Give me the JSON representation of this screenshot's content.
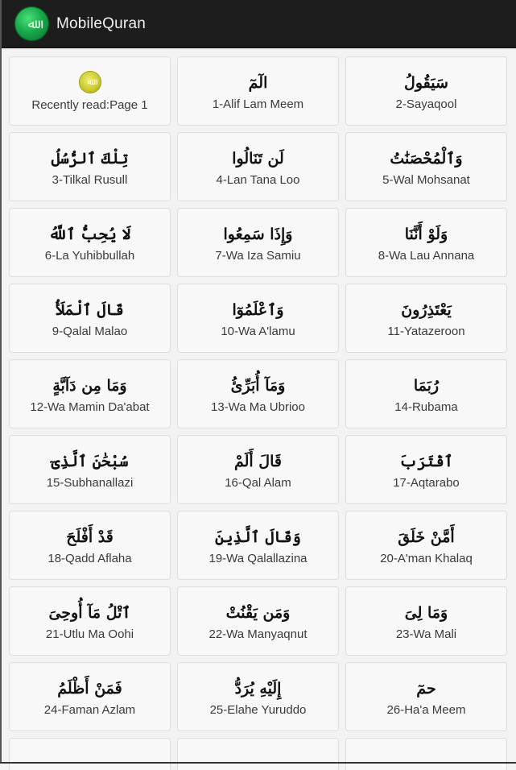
{
  "app": {
    "title": "MobileQuran",
    "icon": "quran-logo-icon"
  },
  "recent": {
    "label": "Recently read:Page 1",
    "icon": "quran-gold-icon"
  },
  "paras": [
    {
      "arabic": "الٓمٓ",
      "label": "1-Alif Lam Meem"
    },
    {
      "arabic": "سَيَقُولُ",
      "label": "2-Sayaqool"
    },
    {
      "arabic": "تِلْكَ ٱلرُّسُلُ",
      "label": "3-Tilkal Rusull"
    },
    {
      "arabic": "لَن تَنَالُوا",
      "label": "4-Lan Tana Loo"
    },
    {
      "arabic": "وَٱلْمُحْصَنَٰتُ",
      "label": "5-Wal Mohsanat"
    },
    {
      "arabic": "لَا يُحِبُّ ٱللَّهُ",
      "label": "6-La Yuhibbullah"
    },
    {
      "arabic": "وَإِذَا سَمِعُوا",
      "label": "7-Wa Iza Samiu"
    },
    {
      "arabic": "وَلَوْ أَنَّنَا",
      "label": "8-Wa Lau Annana"
    },
    {
      "arabic": "قَالَ ٱلْمَلَأُ",
      "label": "9-Qalal Malao"
    },
    {
      "arabic": "وَٱعْلَمُوٓا",
      "label": "10-Wa A'lamu"
    },
    {
      "arabic": "يَعْتَذِرُونَ",
      "label": "11-Yatazeroon"
    },
    {
      "arabic": "وَمَا مِن دَآبَّةٍ",
      "label": "12-Wa Mamin Da'abat"
    },
    {
      "arabic": "وَمَآ أُبَرِّئُ",
      "label": "13-Wa Ma Ubrioo"
    },
    {
      "arabic": "رُبَمَا",
      "label": "14-Rubama"
    },
    {
      "arabic": "سُبْحَٰنَ ٱلَّذِىٓ",
      "label": "15-Subhanallazi"
    },
    {
      "arabic": "قَالَ أَلَمْ",
      "label": "16-Qal Alam"
    },
    {
      "arabic": "ٱقْتَرَبَ",
      "label": "17-Aqtarabo"
    },
    {
      "arabic": "قَدْ أَفْلَحَ",
      "label": "18-Qadd Aflaha"
    },
    {
      "arabic": "وَقَالَ ٱلَّذِينَ",
      "label": "19-Wa Qalallazina"
    },
    {
      "arabic": "أَمَّنْ خَلَقَ",
      "label": "20-A'man Khalaq"
    },
    {
      "arabic": "ٱتْلُ مَآ أُوحِىَ",
      "label": "21-Utlu Ma Oohi"
    },
    {
      "arabic": "وَمَن يَقْنُتْ",
      "label": "22-Wa Manyaqnut"
    },
    {
      "arabic": "وَمَا لِىَ",
      "label": "23-Wa Mali"
    },
    {
      "arabic": "فَمَنْ أَظْلَمُ",
      "label": "24-Faman Azlam"
    },
    {
      "arabic": "إِلَيْهِ يُرَدُّ",
      "label": "25-Elahe Yuruddo"
    },
    {
      "arabic": "حمٓ",
      "label": "26-Ha'a Meem"
    }
  ]
}
